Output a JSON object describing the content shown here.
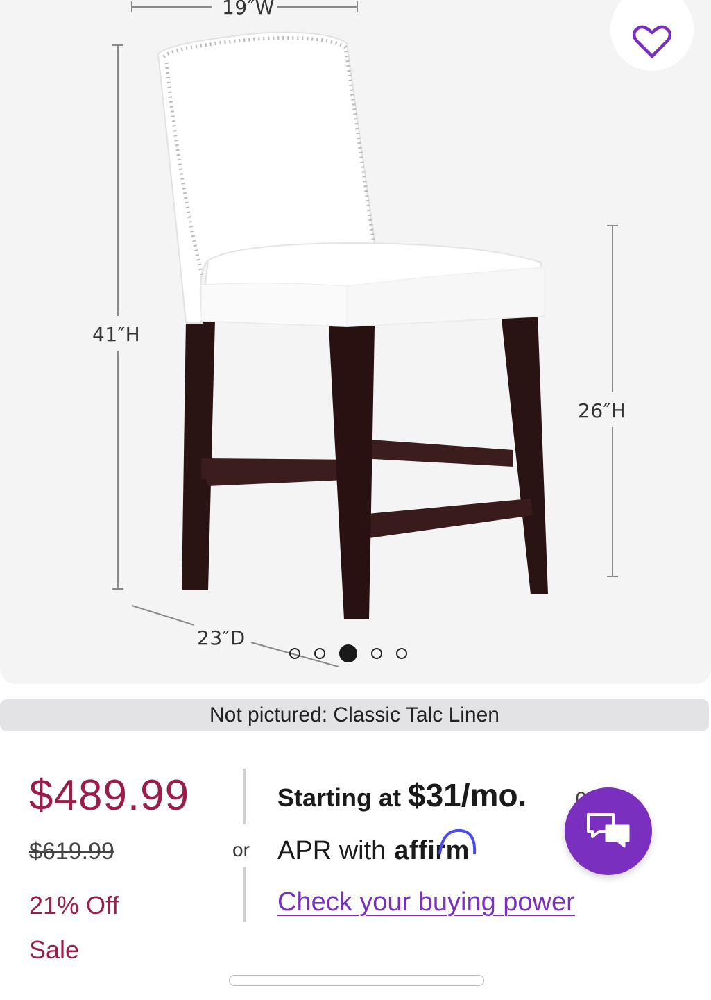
{
  "gallery": {
    "dimensions": {
      "width": "19″W",
      "height": "41″H",
      "seat_height": "26″H",
      "depth": "23″D"
    },
    "dot_count": 5,
    "active_dot_index": 2
  },
  "favorite_icon": "heart-outline-icon",
  "swatch_note": "Not pictured: Classic Talc Linen",
  "pricing": {
    "price": "$489.99",
    "was_price": "$619.99",
    "discount": "21% Off",
    "badge": "Sale"
  },
  "financing": {
    "or_label": "or",
    "starting_prefix": "Starting at ",
    "monthly": "$31/mo.",
    "trailing": "0%",
    "apr_text": "APR with",
    "affirm_brand": "affirm",
    "cta_link": "Check your buying power"
  },
  "chat_icon": "chat-bubbles-icon",
  "colors": {
    "sale_red": "#9b1d49",
    "brand_purple": "#7b2fbf",
    "gallery_bg": "#f4f4f4",
    "pill_bg": "#e3e3e6"
  }
}
